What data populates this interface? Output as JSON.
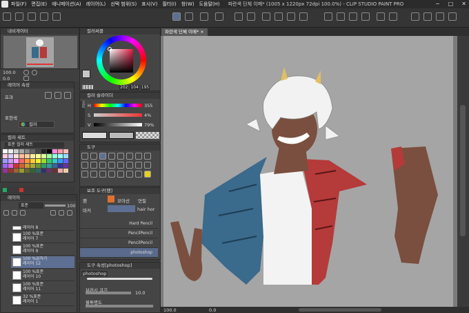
{
  "app": {
    "window_title": "파란색 단체 이메* (1005 x 1220px 72dpi 100.0%)  -  CLIP STUDIO PAINT PRO"
  },
  "menu": [
    "파일(F)",
    "편집(E)",
    "애니메이션(A)",
    "레이어(L)",
    "선택 범위(S)",
    "표시(V)",
    "필터(I)",
    "창(W)",
    "도움말(H)"
  ],
  "window_buttons": [
    "−",
    "□",
    "✕"
  ],
  "document_tab": "파란색 단체 이메* ×",
  "navigator": {
    "title": "내비게이터",
    "zoom": "100.0",
    "angle": "0.0"
  },
  "layer_property": {
    "title": "레이어 속성",
    "effect_label": "효과",
    "expression_label": "표현색",
    "expression_value": "컬러"
  },
  "color_wheel": {
    "title": "컬러써클",
    "values": [
      "202",
      "104",
      "195"
    ]
  },
  "color_slider": {
    "title": "컬러 슬라이더",
    "h_value": "355",
    "s_value": "4%",
    "v_value": "79%",
    "mode_label": "HSV"
  },
  "color_set": {
    "title": "컬러 세트",
    "set_name": "표준 컬러 세트"
  },
  "tool_panel": {
    "title": "도구"
  },
  "sub_tool": {
    "title": "보조 도구[펜]",
    "tabs": [
      "펜",
      "마커",
      "모아선",
      "연필"
    ],
    "selected_extra": "hair hor"
  },
  "brushes": [
    "Hard Pencil",
    "PencilPencil",
    "PencilPencil",
    "photoshop"
  ],
  "tool_property": {
    "title": "도구 속성[photoshop]",
    "brush_name": "photoshop",
    "size_label": "브러시 크기",
    "size_value": "10.0",
    "opacity_label": "불투명도"
  },
  "layer_panel": {
    "title": "레이어",
    "blend": "표준",
    "opacity": "100"
  },
  "layers": [
    {
      "name": "레이어 8",
      "mode": ""
    },
    {
      "name": "레이어 7",
      "mode": "100 %표준"
    },
    {
      "name": "레이어 9",
      "mode": "100 %표준"
    },
    {
      "name": "레이어 12",
      "mode": "100 %곱하기"
    },
    {
      "name": "레이어 10",
      "mode": "100 %표준"
    },
    {
      "name": "레이어 11",
      "mode": "100 %표준"
    },
    {
      "name": "레이어 1",
      "mode": "32 %표준"
    }
  ],
  "status": {
    "zoom": "100.0",
    "angle": "0.0"
  },
  "colors": {
    "accent": "#5d6f92",
    "hair": "#f2f2f2",
    "skin": "#7a4f3f",
    "shirt_blue": "#3a6a8c",
    "shirt_red": "#b53a3a"
  }
}
